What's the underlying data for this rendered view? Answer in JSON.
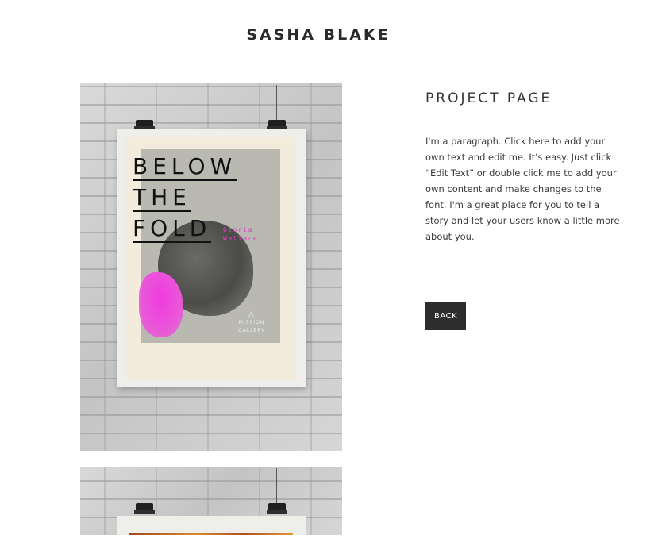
{
  "site": {
    "title": "SASHA BLAKE"
  },
  "project": {
    "title": "PROJECT PAGE",
    "paragraph": "I'm a paragraph. Click here to add your own text and edit me. It's easy. Just click “Edit Text” or double click me to add your own content and make changes to the font. I'm a great place for you to tell a story and let your users know a little more about you.",
    "back_label": "BACK"
  },
  "poster": {
    "headline": [
      "BELOW",
      "THE",
      "FOLD"
    ],
    "artist": "Gloria Wallace",
    "gallery": [
      "MISSION",
      "GALLERY"
    ]
  },
  "colors": {
    "accent_pink": "#e33bc8",
    "button_bg": "#2d2d2d"
  }
}
